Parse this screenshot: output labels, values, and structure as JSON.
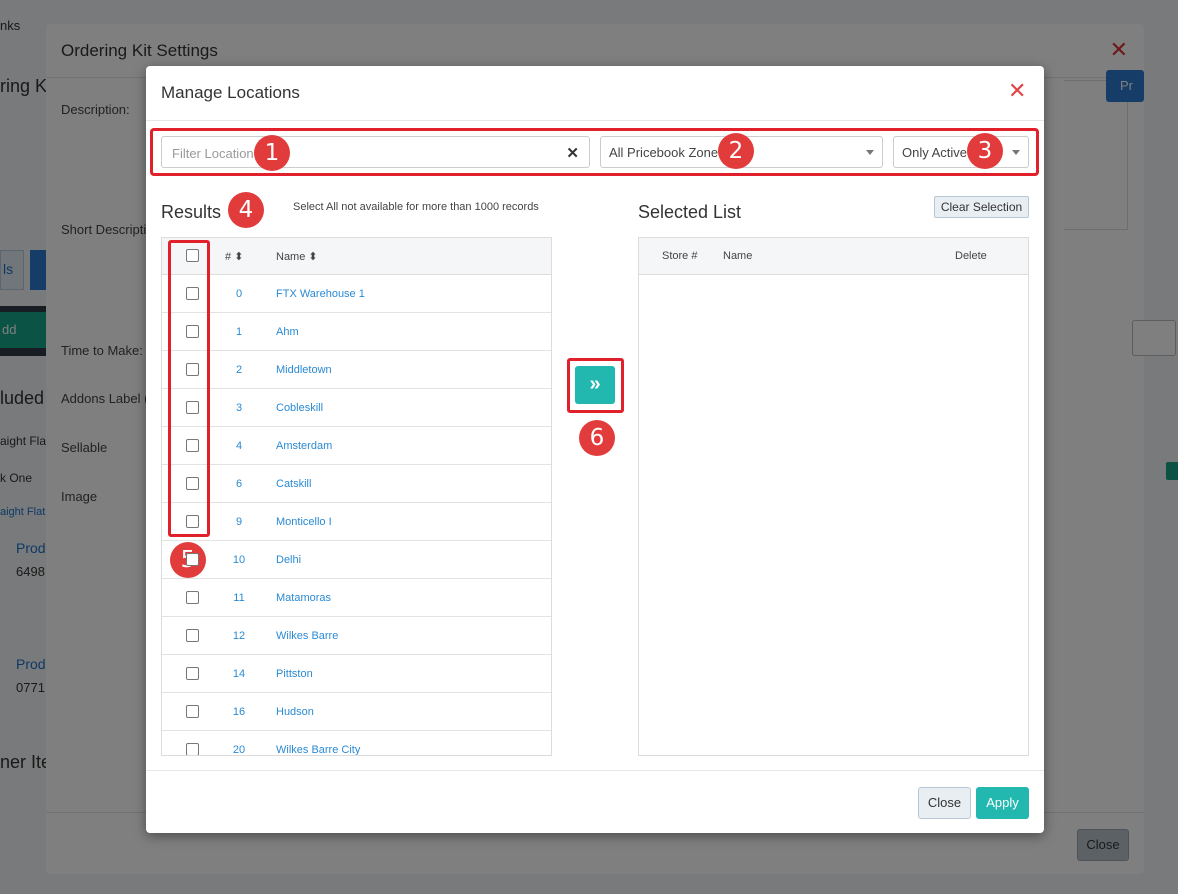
{
  "background": {
    "crumb_text": "nks",
    "page_heading": "ring Ki",
    "tab_label": "ls",
    "add_product_label": "dd Produ",
    "section_included": "luded",
    "row_straight_flat": "aight Fla",
    "row_pick_one": "k One",
    "row_straight_flat_link": "aight Flat",
    "product_1_label": "Prod",
    "product_1_code": "6498",
    "product_2_label": "Prod",
    "product_2_code": "0771",
    "section_other_items": "ner Ite",
    "dropdown_value": "",
    "right_button_1": "",
    "right_button_2": "Pr"
  },
  "outer_modal": {
    "title": "Ordering Kit Settings",
    "labels": {
      "description": "Description:",
      "short_description": "Short Descripti",
      "time_to_make": "Time to Make:",
      "addons_label": "Addons Label (",
      "sellable": "Sellable",
      "image": "Image"
    },
    "close_button": "Close"
  },
  "modal": {
    "title": "Manage Locations",
    "filter": {
      "placeholder": "Filter Location",
      "value": "",
      "pricebook_zone": "All Pricebook Zone",
      "status": "Only Active"
    },
    "results": {
      "title": "Results",
      "note": "Select All not available for more than 1000 records",
      "columns": {
        "number": "#",
        "name": "Name"
      },
      "rows": [
        {
          "num": "0",
          "name": "FTX Warehouse 1"
        },
        {
          "num": "1",
          "name": "Ahm"
        },
        {
          "num": "2",
          "name": "Middletown"
        },
        {
          "num": "3",
          "name": "Cobleskill"
        },
        {
          "num": "4",
          "name": "Amsterdam"
        },
        {
          "num": "6",
          "name": "Catskill"
        },
        {
          "num": "9",
          "name": "Monticello I"
        },
        {
          "num": "10",
          "name": "Delhi"
        },
        {
          "num": "11",
          "name": "Matamoras"
        },
        {
          "num": "12",
          "name": "Wilkes Barre"
        },
        {
          "num": "14",
          "name": "Pittston"
        },
        {
          "num": "16",
          "name": "Hudson"
        },
        {
          "num": "20",
          "name": "Wilkes Barre City"
        }
      ]
    },
    "selected": {
      "title": "Selected List",
      "clear_button": "Clear Selection",
      "columns": {
        "store": "Store #",
        "name": "Name",
        "delete": "Delete"
      }
    },
    "move_button": "»",
    "footer": {
      "close": "Close",
      "apply": "Apply"
    },
    "annotations": {
      "1": "1",
      "2": "2",
      "3": "3",
      "4": "4",
      "5": "5",
      "6": "6"
    }
  },
  "colors": {
    "accent_teal": "#22b8b0",
    "annotation_red": "#e23b3b",
    "link_blue": "#2a8ad4"
  }
}
